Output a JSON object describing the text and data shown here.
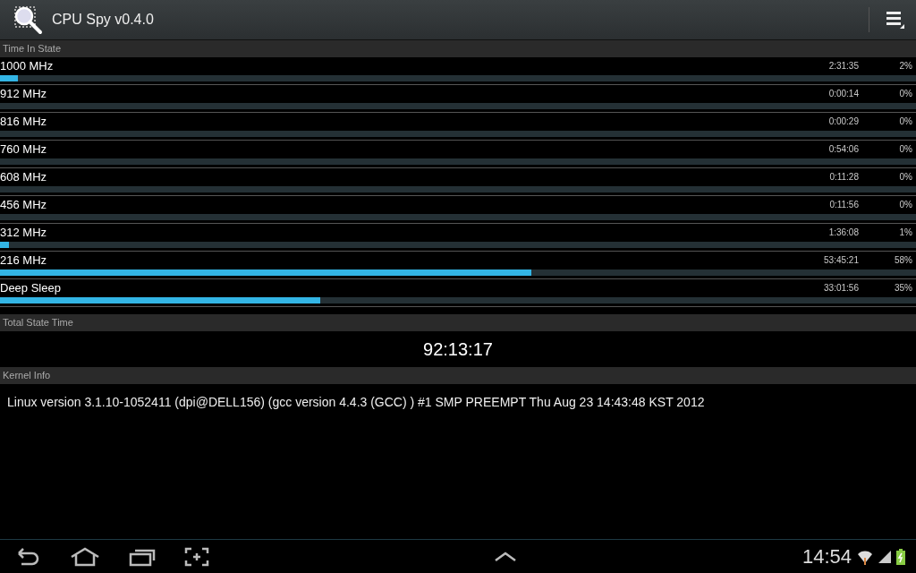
{
  "action_bar": {
    "title": "CPU Spy v0.4.0"
  },
  "time_in_state": {
    "header": "Time In State",
    "states": [
      {
        "name": "1000 MHz",
        "time": "2:31:35",
        "percent": "2%",
        "level": 0.02
      },
      {
        "name": "912 MHz",
        "time": "0:00:14",
        "percent": "0%"
      },
      {
        "name": "816 MHz",
        "time": "0:00:29",
        "percent": "0%"
      },
      {
        "name": "760 MHz",
        "time": "0:54:06",
        "percent": "0%"
      },
      {
        "name": "608 MHz",
        "time": "0:11:28",
        "percent": "0%"
      },
      {
        "name": "456 MHz",
        "time": "0:11:56",
        "percent": "0%"
      },
      {
        "name": "312 MHz",
        "time": "1:36:08",
        "percent": "1%",
        "level": 0.01
      },
      {
        "name": "216 MHz",
        "time": "53:45:21",
        "percent": "58%",
        "level": 0.58
      },
      {
        "name": "Deep Sleep",
        "time": "33:01:56",
        "percent": "35%",
        "level": 0.35
      }
    ]
  },
  "total_state_time": {
    "header": "Total State Time",
    "value": "92:13:17"
  },
  "kernel_info": {
    "header": "Kernel Info",
    "text": "Linux version 3.1.10-1052411 (dpi@DELL156) (gcc version 4.4.3 (GCC) ) #1 SMP PREEMPT Thu Aug 23 14:43:48 KST 2012"
  },
  "system_bar": {
    "clock": "14:54"
  }
}
